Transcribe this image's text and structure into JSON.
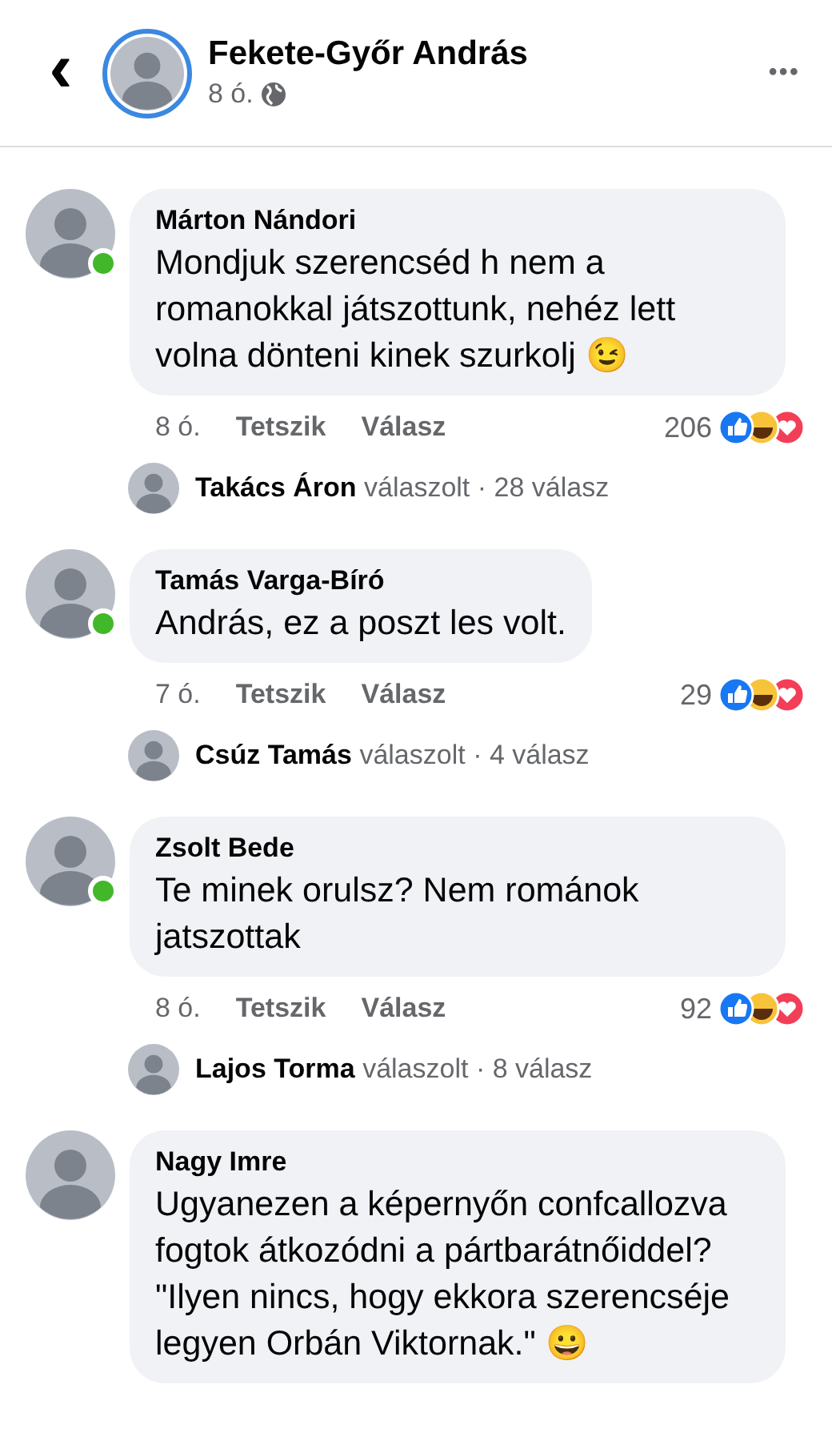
{
  "header": {
    "back": "‹",
    "name": "Fekete-Győr András",
    "time": "8 ó.",
    "menu": "•••"
  },
  "comments": [
    {
      "author": "Márton Nándori",
      "online": true,
      "text": "Mondjuk szerencséd h nem a romanokkal játszottunk, nehéz lett volna dönteni kinek szurkolj 😉",
      "time": "8 ó.",
      "like": "Tetszik",
      "reply": "Válasz",
      "count": "206",
      "replies": {
        "author": "Takács Áron",
        "verb": "válaszolt",
        "count": "· 28 válasz"
      }
    },
    {
      "author": "Tamás Varga-Bíró",
      "online": true,
      "text": "András, ez a poszt les volt.",
      "time": "7 ó.",
      "like": "Tetszik",
      "reply": "Válasz",
      "count": "29",
      "replies": {
        "author": "Csúz Tamás",
        "verb": "válaszolt",
        "count": "· 4 válasz"
      }
    },
    {
      "author": "Zsolt Bede",
      "online": true,
      "text": "Te minek orulsz? Nem románok jatszottak",
      "time": "8 ó.",
      "like": "Tetszik",
      "reply": "Válasz",
      "count": "92",
      "replies": {
        "author": "Lajos Torma",
        "verb": "válaszolt",
        "count": "· 8 válasz"
      }
    },
    {
      "author": "Nagy Imre",
      "online": false,
      "text": "Ugyanezen a képernyőn confcallozva fogtok átkozódni a pártbarátnőiddel? \"Ilyen nincs, hogy ekkora szerencséje legyen Orbán Viktornak.\" 😀"
    }
  ]
}
